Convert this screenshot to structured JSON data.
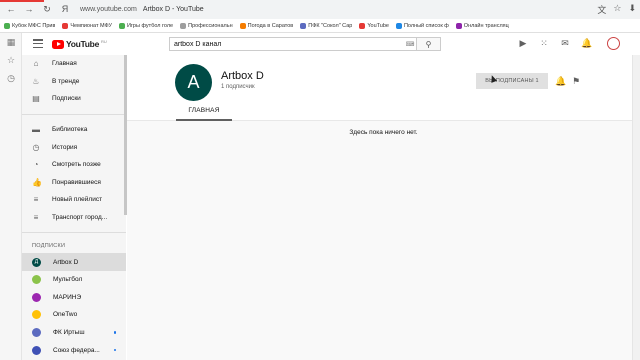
{
  "browser": {
    "url": "www.youtube.com",
    "title": "Artbox D - YouTube",
    "bookmarks": [
      {
        "label": "Кубок МФС Прив",
        "color": "#4caf50"
      },
      {
        "label": "Чемпионат МФУ",
        "color": "#e53935"
      },
      {
        "label": "Игры футбол голе",
        "color": "#4caf50"
      },
      {
        "label": "Профессиональн",
        "color": "#9e9e9e"
      },
      {
        "label": "Погода в Саратов",
        "color": "#f57c00"
      },
      {
        "label": "ПФК \"Сокол\" Сар",
        "color": "#5c6bc0"
      },
      {
        "label": "YouTube",
        "color": "#e53935"
      },
      {
        "label": "Полный список ф",
        "color": "#1e88e5"
      },
      {
        "label": "Онлайн трансляц",
        "color": "#8e24aa"
      }
    ]
  },
  "header": {
    "logo_text": "YouTube",
    "logo_region": "RU",
    "search_value": "artbox D канал"
  },
  "sidebar": {
    "items": [
      {
        "label": "Главная",
        "icon": "home-icon",
        "glyph": "⌂"
      },
      {
        "label": "В тренде",
        "icon": "trending-icon",
        "glyph": "♨"
      },
      {
        "label": "Подписки",
        "icon": "subscriptions-icon",
        "glyph": "▤"
      }
    ],
    "library": [
      {
        "label": "Библиотека",
        "icon": "library-icon",
        "glyph": "▬"
      },
      {
        "label": "История",
        "icon": "history-icon",
        "glyph": "◷"
      },
      {
        "label": "Смотреть позже",
        "icon": "watch-later-icon",
        "glyph": "◔"
      },
      {
        "label": "Понравившиеся",
        "icon": "like-icon",
        "glyph": "👍"
      },
      {
        "label": "Новый плейлист",
        "icon": "playlist-icon",
        "glyph": "≡"
      },
      {
        "label": "Транспорт город...",
        "icon": "playlist-icon",
        "glyph": "≡"
      }
    ],
    "subs_title": "ПОДПИСКИ",
    "subscriptions": [
      {
        "label": "Artbox D",
        "avatar_letter": "Д",
        "color": "#004b46",
        "active": true
      },
      {
        "label": "Мультбол",
        "avatar_letter": "",
        "color": "#8bc34a"
      },
      {
        "label": "МАРИНЭ",
        "avatar_letter": "",
        "color": "#9c27b0"
      },
      {
        "label": "OneTwo",
        "avatar_letter": "",
        "color": "#ffc107"
      },
      {
        "label": "ФК Иртыш",
        "avatar_letter": "",
        "color": "#5c6bc0",
        "dot": true
      },
      {
        "label": "Союз федера...",
        "avatar_letter": "",
        "color": "#3f51b5",
        "dot": true
      }
    ]
  },
  "channel": {
    "avatar_letter": "A",
    "name": "Artbox D",
    "subscribers": "1 подписчик",
    "subscribe_button": "ВЫ ПОДПИСАНЫ 1",
    "tab_home": "ГЛАВНАЯ",
    "empty_text": "Здесь пока ничего нет."
  }
}
